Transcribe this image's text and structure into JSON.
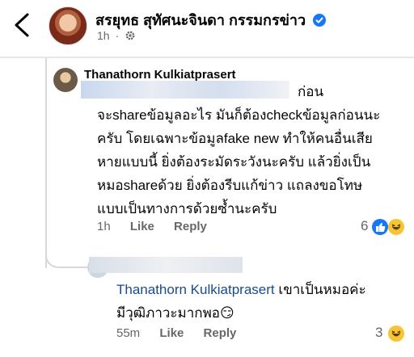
{
  "post": {
    "author": "สรยุทธ สุทัศนะจินดา กรรมกรข่าว",
    "time": "1h",
    "sep": "·"
  },
  "comment1": {
    "author": "Thanathorn Kulkiatprasert",
    "partial_first_line_end": "ก่อน",
    "lines": [
      "จะshareข้อมูลอะไร มันก็ต้องcheckข้อมูลก่อนนะ",
      "ครับ โดยเฉพาะข้อมูลfake new ทำให้คนอื่นเสีย",
      "หายแบบนี้ ยิ่งต้องระมัดระวังนะครับ แล้วยิ่งเป็น",
      "หมอshareด้วย ยิ่งต้องรีบแก้ข่าว แถลงขอโทษ",
      "แบบเป็นทางการด้วยซ้ำนะครับ"
    ],
    "time": "1h",
    "like_label": "Like",
    "reply_label": "Reply",
    "reaction_count": "6"
  },
  "reply1": {
    "mention": "Thanathorn Kulkiatprasert",
    "text_line1": " เขาเป็นหมอค่ะ",
    "text_line2": "มีวุฒิภาวะมากพอ",
    "emoji": "😏",
    "time": "55m",
    "like_label": "Like",
    "reply_label": "Reply",
    "reaction_count": "3"
  },
  "colors": {
    "like": "#1877f2",
    "haha": "#f7c531",
    "meta": "#65676b",
    "mention": "#1a4a8a"
  },
  "icons": {
    "back": "chevron-left-icon",
    "verified": "verified-badge-icon",
    "audience": "gear-icon",
    "like": "like-reaction-icon",
    "haha": "haha-reaction-icon"
  }
}
